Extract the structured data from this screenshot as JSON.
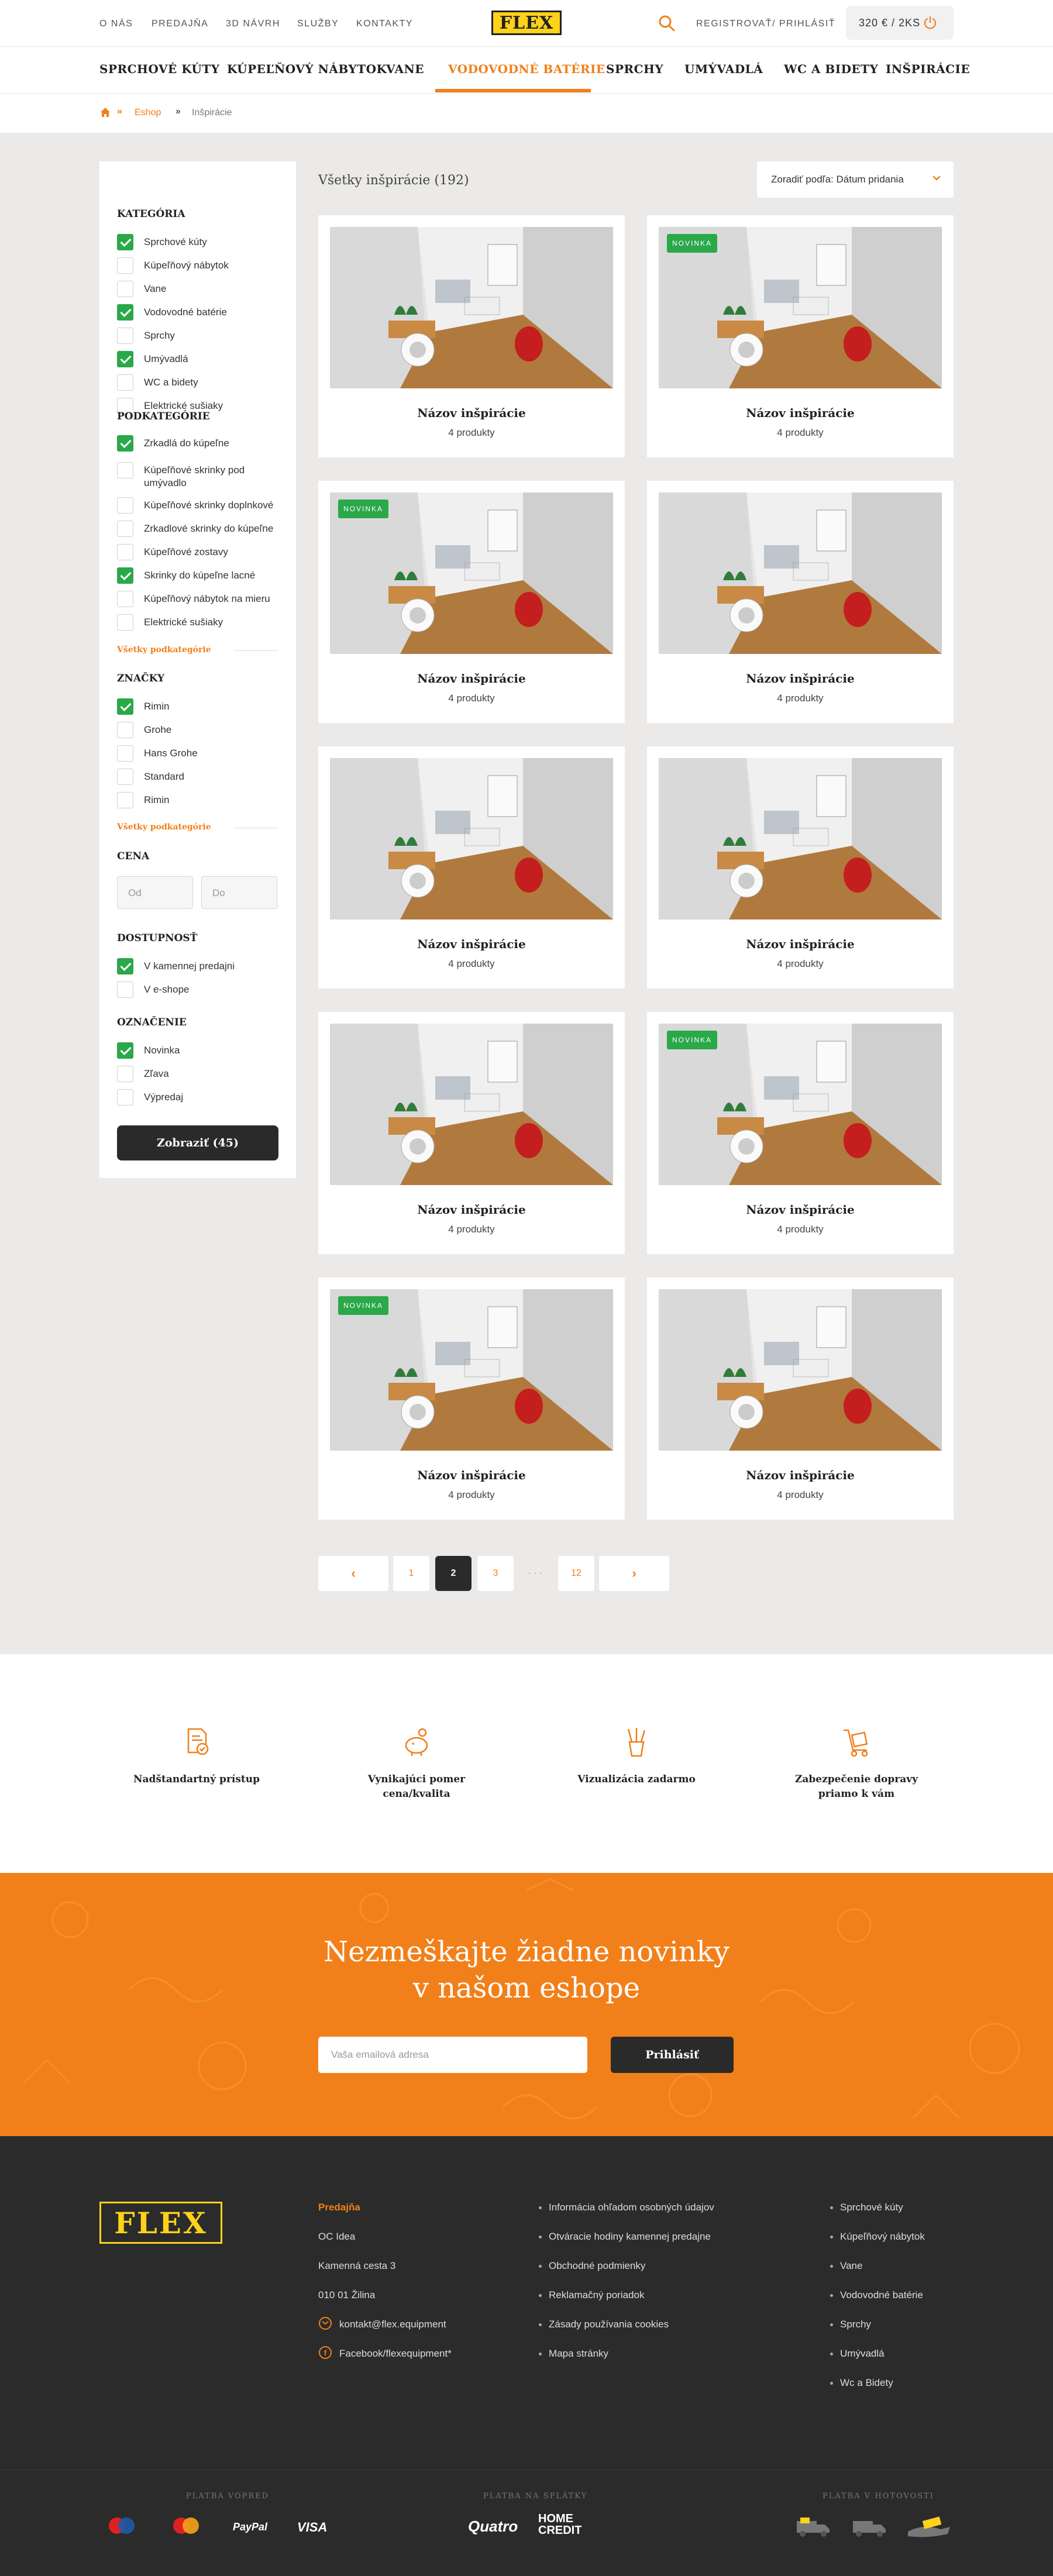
{
  "topbar": {
    "links": [
      "O NÁS",
      "PREDAJŇA",
      "3D NÁVRH",
      "SLUŽBY",
      "KONTAKTY"
    ],
    "logo": "FLEX",
    "register_login": "REGISTROVAŤ/ PRIHLÁSIŤ",
    "cart": "320 € / 2KS"
  },
  "nav": {
    "items": [
      "SPRCHOVÉ KÚTY",
      "KÚPEĽŇOVÝ NÁBYTOK",
      "VANE",
      "VODOVODNÉ BATÉRIE",
      "SPRCHY",
      "UMÝVADLÁ",
      "WC A BIDETY",
      "INŠPIRÁCIE"
    ],
    "active": "VODOVODNÉ BATÉRIE"
  },
  "breadcrumb": {
    "items": [
      "Eshop",
      "Inšpirácie"
    ]
  },
  "sidebar": {
    "category_title": "KATEGÓRIA",
    "categories": [
      {
        "label": "Sprchové kúty",
        "checked": true
      },
      {
        "label": "Kúpeľňový nábytok",
        "checked": false
      },
      {
        "label": "Vane",
        "checked": false
      },
      {
        "label": "Vodovodné batérie",
        "checked": true
      },
      {
        "label": "Sprchy",
        "checked": false
      },
      {
        "label": "Umývadlá",
        "checked": true
      },
      {
        "label": "WC a bidety",
        "checked": false
      },
      {
        "label": "Elektrické sušiaky",
        "checked": false
      }
    ],
    "subcategory_title": "PODKATEGÓRIE",
    "subcategories": [
      {
        "label": "Zrkadlá do kúpeľne",
        "checked": true
      },
      {
        "label": "Kúpeľňové skrinky pod umývadlo",
        "checked": false
      },
      {
        "label": "Kúpeľňové skrinky doplnkové",
        "checked": false
      },
      {
        "label": "Zrkadlové skrinky do kúpeľne",
        "checked": false
      },
      {
        "label": "Kúpeľňové zostavy",
        "checked": false
      },
      {
        "label": "Skrinky do kúpeľne lacné",
        "checked": true
      },
      {
        "label": "Kúpeľňový nábytok na mieru",
        "checked": false
      },
      {
        "label": "Elektrické sušiaky",
        "checked": false
      }
    ],
    "all_subcategories": "Všetky podkategórie",
    "brands_title": "ZNAČKY",
    "brands": [
      {
        "label": "Rimin",
        "checked": true
      },
      {
        "label": "Grohe",
        "checked": false
      },
      {
        "label": "Hans Grohe",
        "checked": false
      },
      {
        "label": "Standard",
        "checked": false
      },
      {
        "label": "Rimin",
        "checked": false
      }
    ],
    "all_brands": "Všetky podkategórie",
    "price_title": "CENA",
    "price_from_placeholder": "Od",
    "price_to_placeholder": "Do",
    "availability_title": "DOSTUPNOSŤ",
    "availability": [
      {
        "label": "V kamennej predajni",
        "checked": true
      },
      {
        "label": "V e-shope",
        "checked": false
      }
    ],
    "label_title": "OZNAČENIE",
    "labels": [
      {
        "label": "Novinka",
        "checked": true
      },
      {
        "label": "Zľava",
        "checked": false
      },
      {
        "label": "Výpredaj",
        "checked": false
      }
    ],
    "show_button": "Zobraziť (45)"
  },
  "list": {
    "title": "Všetky inšpirácie (192)",
    "sort": "Zoradiť podľa: Dátum pridania"
  },
  "cards": [
    {
      "title": "Názov inšpirácie",
      "subtitle": "4 produkty",
      "badge": ""
    },
    {
      "title": "Názov inšpirácie",
      "subtitle": "4 produkty",
      "badge": "NOVINKA"
    },
    {
      "title": "Názov inšpirácie",
      "subtitle": "4 produkty",
      "badge": "NOVINKA"
    },
    {
      "title": "Názov inšpirácie",
      "subtitle": "4 produkty",
      "badge": ""
    },
    {
      "title": "Názov inšpirácie",
      "subtitle": "4 produkty",
      "badge": ""
    },
    {
      "title": "Názov inšpirácie",
      "subtitle": "4 produkty",
      "badge": ""
    },
    {
      "title": "Názov inšpirácie",
      "subtitle": "4 produkty",
      "badge": ""
    },
    {
      "title": "Názov inšpirácie",
      "subtitle": "4 produkty",
      "badge": "NOVINKA"
    },
    {
      "title": "Názov inšpirácie",
      "subtitle": "4 produkty",
      "badge": "NOVINKA"
    },
    {
      "title": "Názov inšpirácie",
      "subtitle": "4 produkty",
      "badge": ""
    }
  ],
  "pagination": {
    "prev": "‹",
    "pages": [
      "1",
      "2",
      "3",
      "12"
    ],
    "ellipsis": "· · ·",
    "next": "›",
    "current": "2"
  },
  "features": [
    {
      "label": "Nadštandartný prístup",
      "icon": "document-badge-icon"
    },
    {
      "label": "Vynikajúci pomer cena/kvalita",
      "icon": "piggy-bank-icon"
    },
    {
      "label": "Vizualizácia zadarmo",
      "icon": "pencil-cup-icon"
    },
    {
      "label": "Zabezpečenie dopravy priamo k vám",
      "icon": "delivery-cart-icon"
    }
  ],
  "newsletter": {
    "title_line1": "Nezmeškajte žiadne novinky",
    "title_line2": "v našom eshope",
    "email_placeholder": "Vaša emailová adresa",
    "button": "Prihlásiť"
  },
  "footer": {
    "logo": "FLEX",
    "store_title": "Predajňa",
    "address": [
      "OC Idea",
      "Kamenná cesta 3",
      "010 01 Žilina"
    ],
    "email": "kontakt@flex.equipment",
    "facebook": "Facebook/flexequipment*",
    "info_links": [
      "Informácia ohľadom osobných údajov",
      "Otváracie hodiny kamennej predajne",
      "Obchodné podmienky",
      "Reklamačný poriadok",
      "Zásady používania cookies",
      "Mapa stránky"
    ],
    "category_links": [
      "Sprchové kúty",
      "Kúpeľňový nábytok",
      "Vane",
      "Vodovodné batérie",
      "Sprchy",
      "Umývadlá",
      "Wc a Bidety"
    ],
    "pay_online_title": "PLATBA VOPRED",
    "pay_online": [
      "Maestro",
      "Mastercard",
      "PayPal",
      "VISA"
    ],
    "pay_installments_title": "PLATBA NA SPLÁTKY",
    "pay_installments": [
      "Quatro",
      "HOME CREDIT"
    ],
    "pay_cash_title": "PLATBA V HOTOVOSTI"
  },
  "colors": {
    "accent": "#f08019",
    "check": "#2aa84a",
    "dark": "#2b2b2b",
    "bg": "#ebeae8",
    "logo_yellow": "#ffd21a"
  }
}
